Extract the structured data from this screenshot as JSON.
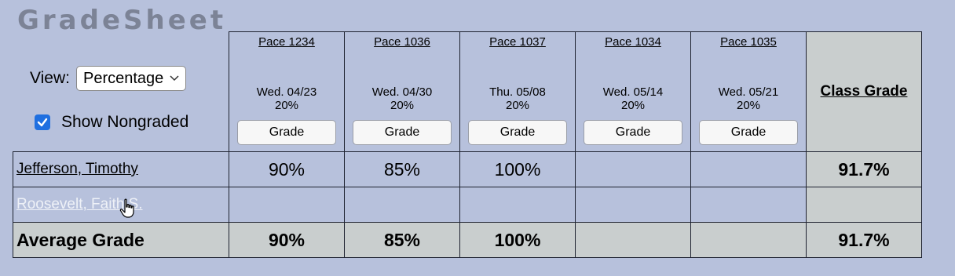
{
  "app": {
    "title": "GradeSheet"
  },
  "controls": {
    "view_label": "View:",
    "view_selected": "Percentage",
    "show_nongraded_label": "Show Nongraded",
    "show_nongraded_checked": true
  },
  "columns": [
    {
      "pace": "Pace 1234",
      "date": "Wed. 04/23",
      "weight": "20%",
      "button": "Grade"
    },
    {
      "pace": "Pace 1036",
      "date": "Wed. 04/30",
      "weight": "20%",
      "button": "Grade"
    },
    {
      "pace": "Pace 1037",
      "date": "Thu. 05/08",
      "weight": "20%",
      "button": "Grade"
    },
    {
      "pace": "Pace 1034",
      "date": "Wed. 05/14",
      "weight": "20%",
      "button": "Grade"
    },
    {
      "pace": "Pace 1035",
      "date": "Wed. 05/21",
      "weight": "20%",
      "button": "Grade"
    }
  ],
  "class_grade_header": "Class Grade",
  "students": [
    {
      "name": "Jefferson, Timothy",
      "grades": [
        "90%",
        "85%",
        "100%",
        "",
        ""
      ],
      "class_grade": "91.7%"
    },
    {
      "name": "Roosevelt, Faith S.",
      "grades": [
        "",
        "",
        "",
        "",
        ""
      ],
      "class_grade": ""
    }
  ],
  "average": {
    "label": "Average Grade",
    "grades": [
      "90%",
      "85%",
      "100%",
      "",
      ""
    ],
    "class_grade": "91.7%"
  },
  "colors": {
    "background": "#b7c1dc",
    "header_gray": "#c9cece",
    "checkbox_blue": "#1f6fe0"
  }
}
